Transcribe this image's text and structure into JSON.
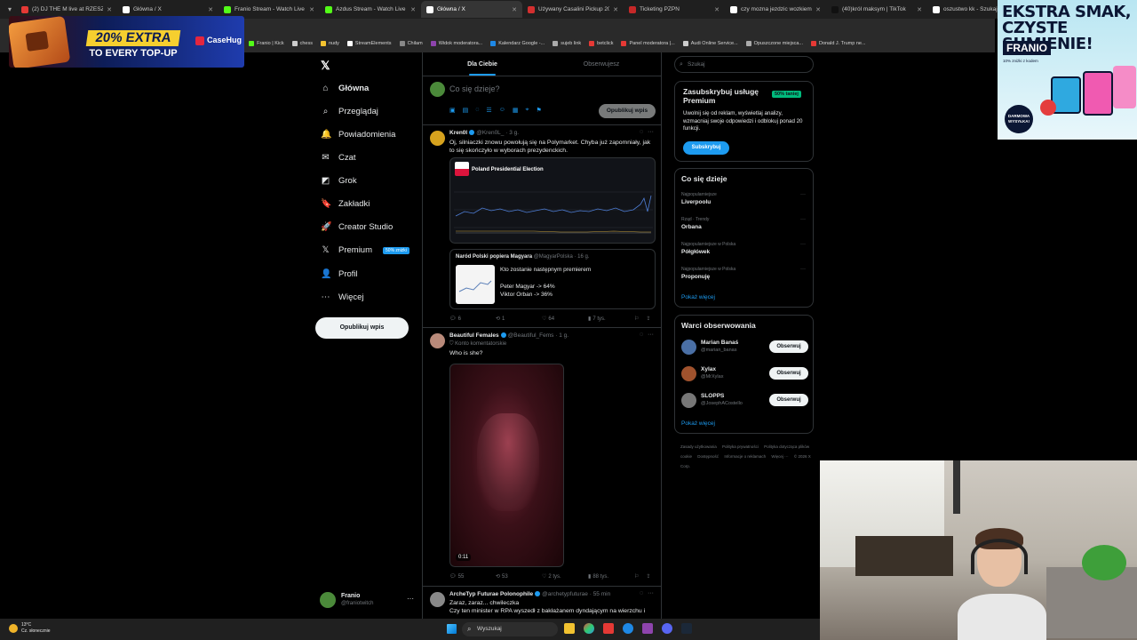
{
  "browser": {
    "tabs": [
      {
        "title": "(2) DJ THE M live at RZESZOWSKA",
        "color": "#e53935",
        "active": false
      },
      {
        "title": "Główna / X",
        "color": "#ffffff",
        "active": false
      },
      {
        "title": "Franio Stream - Watch Live on Kick",
        "color": "#53fc18",
        "active": false
      },
      {
        "title": "Azdus Stream - Watch Live on Kick",
        "color": "#53fc18",
        "active": false
      },
      {
        "title": "Główna / X",
        "color": "#ffffff",
        "active": true
      },
      {
        "title": "Używany Casalini Pickup 2008 ...",
        "color": "#d32f2f",
        "active": false
      },
      {
        "title": "Ticketing PZPN",
        "color": "#c62828",
        "active": false
      },
      {
        "title": "czy mozna jezdzic wozkiem inwalidzkim",
        "color": "#ffffff",
        "active": false
      },
      {
        "title": "(40)król maksym | TikTok",
        "color": "#111111",
        "active": false
      },
      {
        "title": "oszustwo kk - Szukaj w Google",
        "color": "#ffffff",
        "active": false
      }
    ],
    "bookmarks": [
      "Franio | Kick",
      "chess",
      "nudy",
      "StreamElements",
      "Chilam",
      "Widok moderatora...",
      "Kalendarz Google -...",
      "sujeb link",
      "betclick",
      "Panel moderatora |...",
      "Audi Online Service...",
      "Opuszczone miejsca...",
      "Donald J. Trump ne..."
    ],
    "bookmark_prefix": "op"
  },
  "ads": {
    "left": {
      "headline": "20% EXTRA",
      "sub": "TO EVERY TOP-UP",
      "brand": "CaseHug"
    },
    "right": {
      "headline": "EKSTRA SMAK, CZYSTE SUMIENIE!",
      "brand": "FRANIO",
      "note": "10% zniżki z kodem",
      "badge": "DARMOWA WYSYŁKA!"
    }
  },
  "nav": {
    "items": [
      {
        "label": "Główna",
        "icon": "home-icon",
        "glyph": "⌂",
        "active": true
      },
      {
        "label": "Przeglądaj",
        "icon": "search-icon",
        "glyph": "⌕"
      },
      {
        "label": "Powiadomienia",
        "icon": "bell-icon",
        "glyph": "🔔"
      },
      {
        "label": "Czat",
        "icon": "mail-icon",
        "glyph": "✉"
      },
      {
        "label": "Grok",
        "icon": "grok-icon",
        "glyph": "◩"
      },
      {
        "label": "Zakładki",
        "icon": "bookmark-icon",
        "glyph": "🔖"
      },
      {
        "label": "Creator Studio",
        "icon": "rocket-icon",
        "glyph": "🚀"
      },
      {
        "label": "Premium",
        "icon": "x-logo-icon",
        "glyph": "𝕏",
        "badge": "50% zniżki"
      },
      {
        "label": "Profil",
        "icon": "person-icon",
        "glyph": "👤"
      },
      {
        "label": "Więcej",
        "icon": "more-circle-icon",
        "glyph": "⋯"
      }
    ],
    "post_button": "Opublikuj wpis",
    "profile": {
      "name": "Franio",
      "handle": "@franiotwitch"
    }
  },
  "timeline": {
    "tabs": [
      "Dla Ciebie",
      "Obserwujesz"
    ],
    "compose_placeholder": "Co się dzieje?",
    "compose_button": "Opublikuj wpis",
    "tweets": [
      {
        "name": "Kren0l",
        "handle": "@Kren0L_",
        "time": "3 g.",
        "text": "Oj, silniaczki znowu powołują się na Polymarket. Chyba już zapomniały, jak to się skończyło w wyborach prezydenckich.",
        "embed_title": "Poland Presidential Election",
        "quote": {
          "name": "Naród Polski popiera Magyara",
          "handle": "@MagyarPolska",
          "time": "16 g.",
          "text": "Kto zostanie następnym premierem",
          "lines": [
            "Peter Magyar -> 64%",
            "Viktor Orban -> 36%"
          ]
        },
        "stats": {
          "reply": "6",
          "retweet": "1",
          "like": "64",
          "views": "7 tys."
        }
      },
      {
        "name": "Beautiful Females",
        "handle": "@Beautiful_Fems",
        "time": "1 g.",
        "sub": "Konto komentatorskie",
        "text": "Who is she?",
        "video_time": "0:11",
        "stats": {
          "reply": "55",
          "retweet": "53",
          "like": "2 tys.",
          "views": "88 tys."
        }
      },
      {
        "name": "ArcheTyp Futurae Polonophile",
        "handle": "@archetypfuturae",
        "time": "55 min",
        "text_line1": "Zaraz, zaraz... chwileczka",
        "text_line2": "Czy ten minister w RPA wyszedł z bakłażanem dyndającym na wierzchu i"
      }
    ]
  },
  "sidebar": {
    "search_placeholder": "Szukaj",
    "premium": {
      "title": "Zasubskrybuj usługę Premium",
      "badge": "50% taniej",
      "text": "Uwolnij się od reklam, wyświetlaj analizy, wzmacniaj swoje odpowiedzi i odblokuj ponad 20 funkcji.",
      "button": "Subskrybuj"
    },
    "trends": {
      "title": "Co się dzieje",
      "items": [
        {
          "category": "Najpopularniejsze",
          "name": "Liverpoolu"
        },
        {
          "category": "Rząd · Trendy",
          "name": "Orbana"
        },
        {
          "category": "Najpopularniejsze w Polska",
          "name": "Półgłówek"
        },
        {
          "category": "Najpopularniejsze w Polska",
          "name": "Proponuję"
        }
      ],
      "more": "Pokaż więcej"
    },
    "follow": {
      "title": "Warci obserwowania",
      "items": [
        {
          "name": "Marian Banaś",
          "handle": "@marian_banas",
          "button": "Obserwuj",
          "color": "#4a6fa5"
        },
        {
          "name": "Xylax",
          "handle": "@MrXylax",
          "button": "Obserwuj",
          "color": "#a0522d"
        },
        {
          "name": "SLOPPS",
          "handle": "@JosephACostello",
          "button": "Obserwuj",
          "color": "#777777"
        }
      ],
      "more": "Pokaż więcej"
    },
    "footer": [
      "Zasady użytkowania",
      "Polityka prywatności",
      "Polityka dotycząca plików cookie",
      "Dostępność",
      "Informacje o reklamach",
      "Więcej ···",
      "© 2026 X Corp."
    ]
  },
  "taskbar": {
    "temp": "13°C",
    "weather": "Cz. słonecznie",
    "search": "Wyszukaj"
  },
  "colors": {
    "accent": "#1d9bf0",
    "bg": "#000000",
    "border": "#2f3336",
    "muted": "#71767b"
  }
}
